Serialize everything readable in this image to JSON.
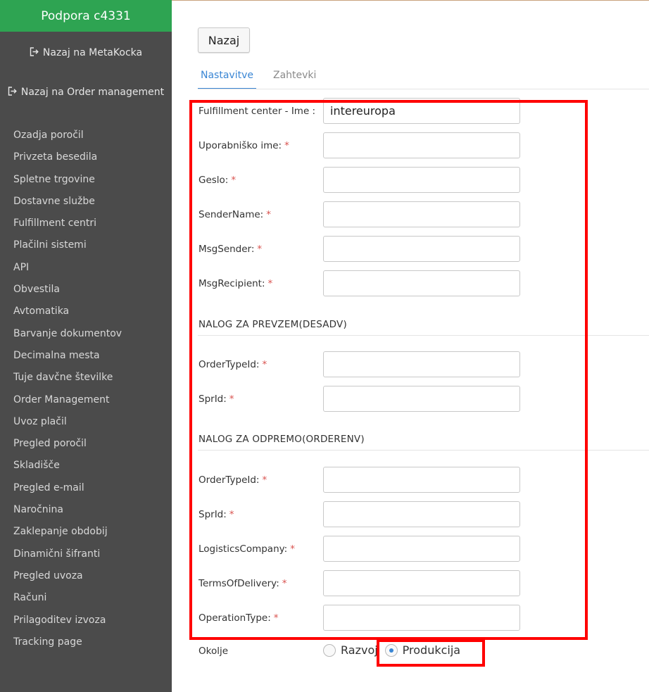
{
  "sidebar": {
    "header": "Podpora c4331",
    "back_links": [
      "Nazaj na MetaKocka",
      "Nazaj na Order management"
    ],
    "items": [
      "Ozadja poročil",
      "Privzeta besedila",
      "Spletne trgovine",
      "Dostavne službe",
      "Fulfillment centri",
      "Plačilni sistemi",
      "API",
      "Obvestila",
      "Avtomatika",
      "Barvanje dokumentov",
      "Decimalna mesta",
      "Tuje davčne številke",
      "Order Management",
      "Uvoz plačil",
      "Pregled poročil",
      "Skladišče",
      "Pregled e-mail",
      "Naročnina",
      "Zaklepanje obdobij",
      "Dinamični šifranti",
      "Pregled uvoza",
      "Računi",
      "Prilagoditev izvoza",
      "Tracking page"
    ]
  },
  "main": {
    "back_button": "Nazaj",
    "tabs": [
      "Nastavitve",
      "Zahtevki"
    ],
    "fields": [
      {
        "label": "Fulfillment center - Ime :",
        "value": "intereuropa",
        "required": ""
      },
      {
        "label": "Uporabniško ime:",
        "value": "",
        "required": "*"
      },
      {
        "label": "Geslo:",
        "value": "",
        "required": "*"
      },
      {
        "label": "SenderName:",
        "value": "",
        "required": "*"
      },
      {
        "label": "MsgSender:",
        "value": "",
        "required": "*"
      },
      {
        "label": "MsgRecipient:",
        "value": "",
        "required": "*"
      }
    ],
    "section_desadv": {
      "title": "NALOG ZA PREVZEM(DESADV)",
      "fields": [
        {
          "label": "OrderTypeId:",
          "value": "",
          "required": "*"
        },
        {
          "label": "SprId:",
          "value": "",
          "required": "*"
        }
      ]
    },
    "section_orderenv": {
      "title": "NALOG ZA ODPREMO(ORDERENV)",
      "fields": [
        {
          "label": "OrderTypeId:",
          "value": "",
          "required": "*"
        },
        {
          "label": "SprId:",
          "value": "",
          "required": "*"
        },
        {
          "label": "LogisticsCompany:",
          "value": "",
          "required": "*"
        },
        {
          "label": "TermsOfDelivery:",
          "value": "",
          "required": "*"
        },
        {
          "label": "OperationType:",
          "value": "",
          "required": "*"
        }
      ]
    },
    "environment": {
      "label": "Okolje",
      "options": [
        "Razvoj",
        "Produkcija"
      ],
      "selected": "Produkcija"
    }
  },
  "colors": {
    "sidebar_bg": "#4b4b4b",
    "header_green": "#2ea452",
    "accent_blue": "#3a86d4",
    "required_red": "#d9534f",
    "highlight_red": "#ff0000"
  }
}
